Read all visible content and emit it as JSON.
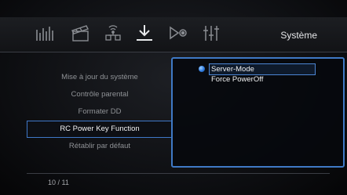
{
  "header": {
    "title": "Système",
    "icons": [
      {
        "name": "music-bars-icon",
        "active": false
      },
      {
        "name": "movie-clapper-icon",
        "active": false
      },
      {
        "name": "network-icon",
        "active": false
      },
      {
        "name": "download-icon",
        "active": true
      },
      {
        "name": "play-settings-icon",
        "active": false
      },
      {
        "name": "sliders-icon",
        "active": false
      }
    ]
  },
  "menu": {
    "items": [
      {
        "label": "Mise à jour du système"
      },
      {
        "label": "Contrôle parental"
      },
      {
        "label": "Formater DD"
      },
      {
        "label": "RC Power Key Function",
        "selected": true
      },
      {
        "label": "Rétablir par défaut"
      }
    ]
  },
  "options": {
    "items": [
      {
        "label": "Server-Mode",
        "selected": true
      },
      {
        "label": "Force PowerOff"
      }
    ]
  },
  "footer": {
    "page": "10 / 11"
  },
  "colors": {
    "accent": "#3f79c5",
    "background": "#0c0d10"
  }
}
